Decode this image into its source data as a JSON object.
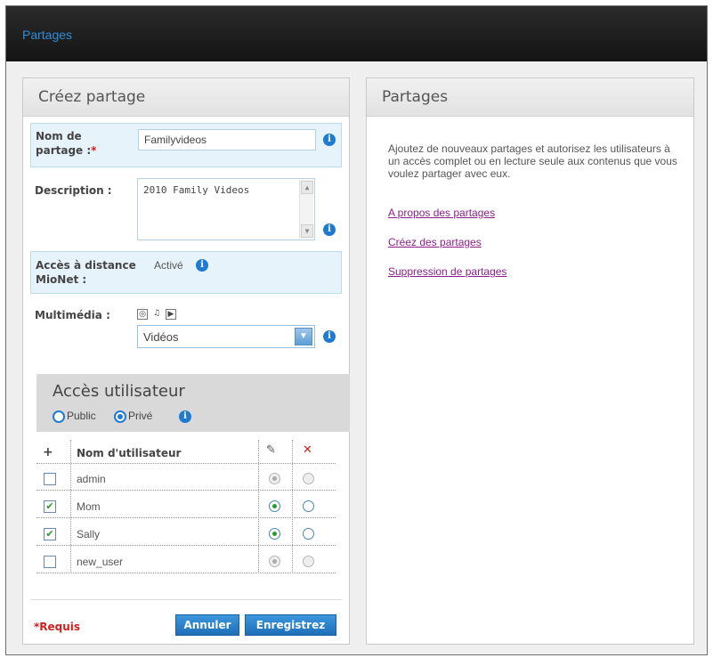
{
  "header": {
    "title": "Partages"
  },
  "create_panel": {
    "title": "Créez partage",
    "share_name": {
      "label": "Nom de partage :",
      "required_marker": "*",
      "value": "Familyvideos"
    },
    "description": {
      "label": "Description :",
      "value": "2010 Family  Videos"
    },
    "remote_access": {
      "label": "Accès à distance MioNet :",
      "value": "Activé"
    },
    "media": {
      "label": "Multimédia :",
      "icons": [
        "camera-icon",
        "music-icon",
        "video-icon"
      ],
      "selected": "Vidéos"
    },
    "user_access": {
      "title": "Accès utilisateur",
      "options": [
        "Public",
        "Privé"
      ],
      "selected": "Privé",
      "table": {
        "headers": {
          "add": "+",
          "username": "Nom d'utilisateur",
          "write_icon": "pencil-icon",
          "deny_icon": "x-icon"
        },
        "rows": [
          {
            "name": "admin",
            "checked": false,
            "access": "write",
            "disabled": true
          },
          {
            "name": "Mom",
            "checked": true,
            "access": "write",
            "disabled": false
          },
          {
            "name": "Sally",
            "checked": true,
            "access": "write",
            "disabled": false
          },
          {
            "name": "new_user",
            "checked": false,
            "access": "write",
            "disabled": true
          }
        ]
      }
    },
    "required_note": "*Requis",
    "cancel_label": "Annuler",
    "save_label": "Enregistrez"
  },
  "help_panel": {
    "title": "Partages",
    "text": "Ajoutez de nouveaux partages et autorisez les utilisateurs à un accès complet ou en lecture seule aux contenus que vous voulez partager avec eux.",
    "links": [
      "A propos des partages",
      "Créez des partages",
      "Suppression de partages"
    ]
  },
  "colors": {
    "accent": "#1f7bd1",
    "header_bg": "#1c1c1c",
    "link": "#8a1f8a",
    "required": "#cf2020"
  }
}
